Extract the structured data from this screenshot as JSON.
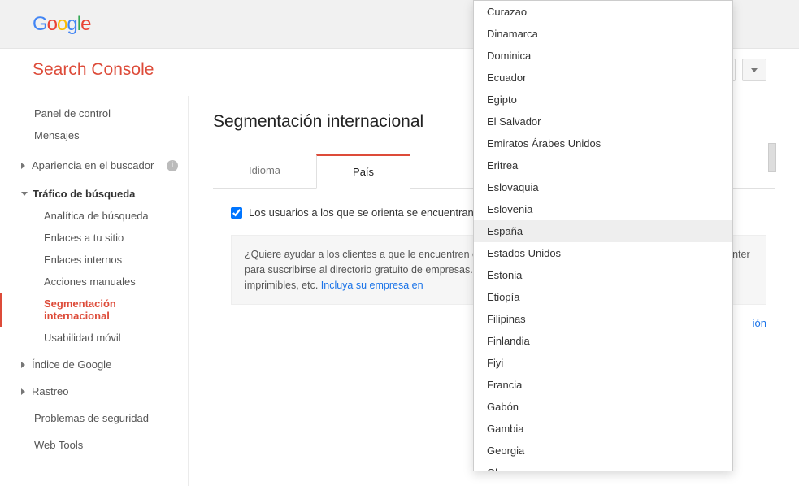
{
  "header": {
    "logo_letters": [
      "G",
      "o",
      "o",
      "g",
      "l",
      "e"
    ],
    "product": "Search Console",
    "property_favicon": "⚡"
  },
  "sidebar": {
    "dashboard": "Panel de control",
    "messages": "Mensajes",
    "appearance": "Apariencia en el buscador",
    "traffic_group": "Tráfico de búsqueda",
    "traffic_items": {
      "analytics": "Analítica de búsqueda",
      "links_to_site": "Enlaces a tu sitio",
      "internal_links": "Enlaces internos",
      "manual_actions": "Acciones manuales",
      "intl_targeting": "Segmentación internacional",
      "mobile_usability": "Usabilidad móvil"
    },
    "google_index": "Índice de Google",
    "crawl": "Rastreo",
    "security": "Problemas de seguridad",
    "webtools": "Web Tools"
  },
  "main": {
    "title": "Segmentación internacional",
    "tab_language": "Idioma",
    "tab_country": "País",
    "targeting_label": "Los usuarios a los que se orienta se encuentran en:",
    "promo_text": "¿Quiere ayudar a los clientes a que le encuentren en Google Maps? Visite ahora nuestro Local Business Center para suscribirse al directorio gratuito de empresas. Puede incluir su dirección, horas de servicio, cupones imprimibles, etc. ",
    "promo_link": "Incluya su empresa en",
    "link_fragment": "ión"
  },
  "dropdown": {
    "items": [
      "Curazao",
      "Dinamarca",
      "Dominica",
      "Ecuador",
      "Egipto",
      "El Salvador",
      "Emiratos Árabes Unidos",
      "Eritrea",
      "Eslovaquia",
      "Eslovenia",
      "España",
      "Estados Unidos",
      "Estonia",
      "Etiopía",
      "Filipinas",
      "Finlandia",
      "Fiyi",
      "Francia",
      "Gabón",
      "Gambia",
      "Georgia",
      "Ghana"
    ],
    "selected": "España"
  }
}
